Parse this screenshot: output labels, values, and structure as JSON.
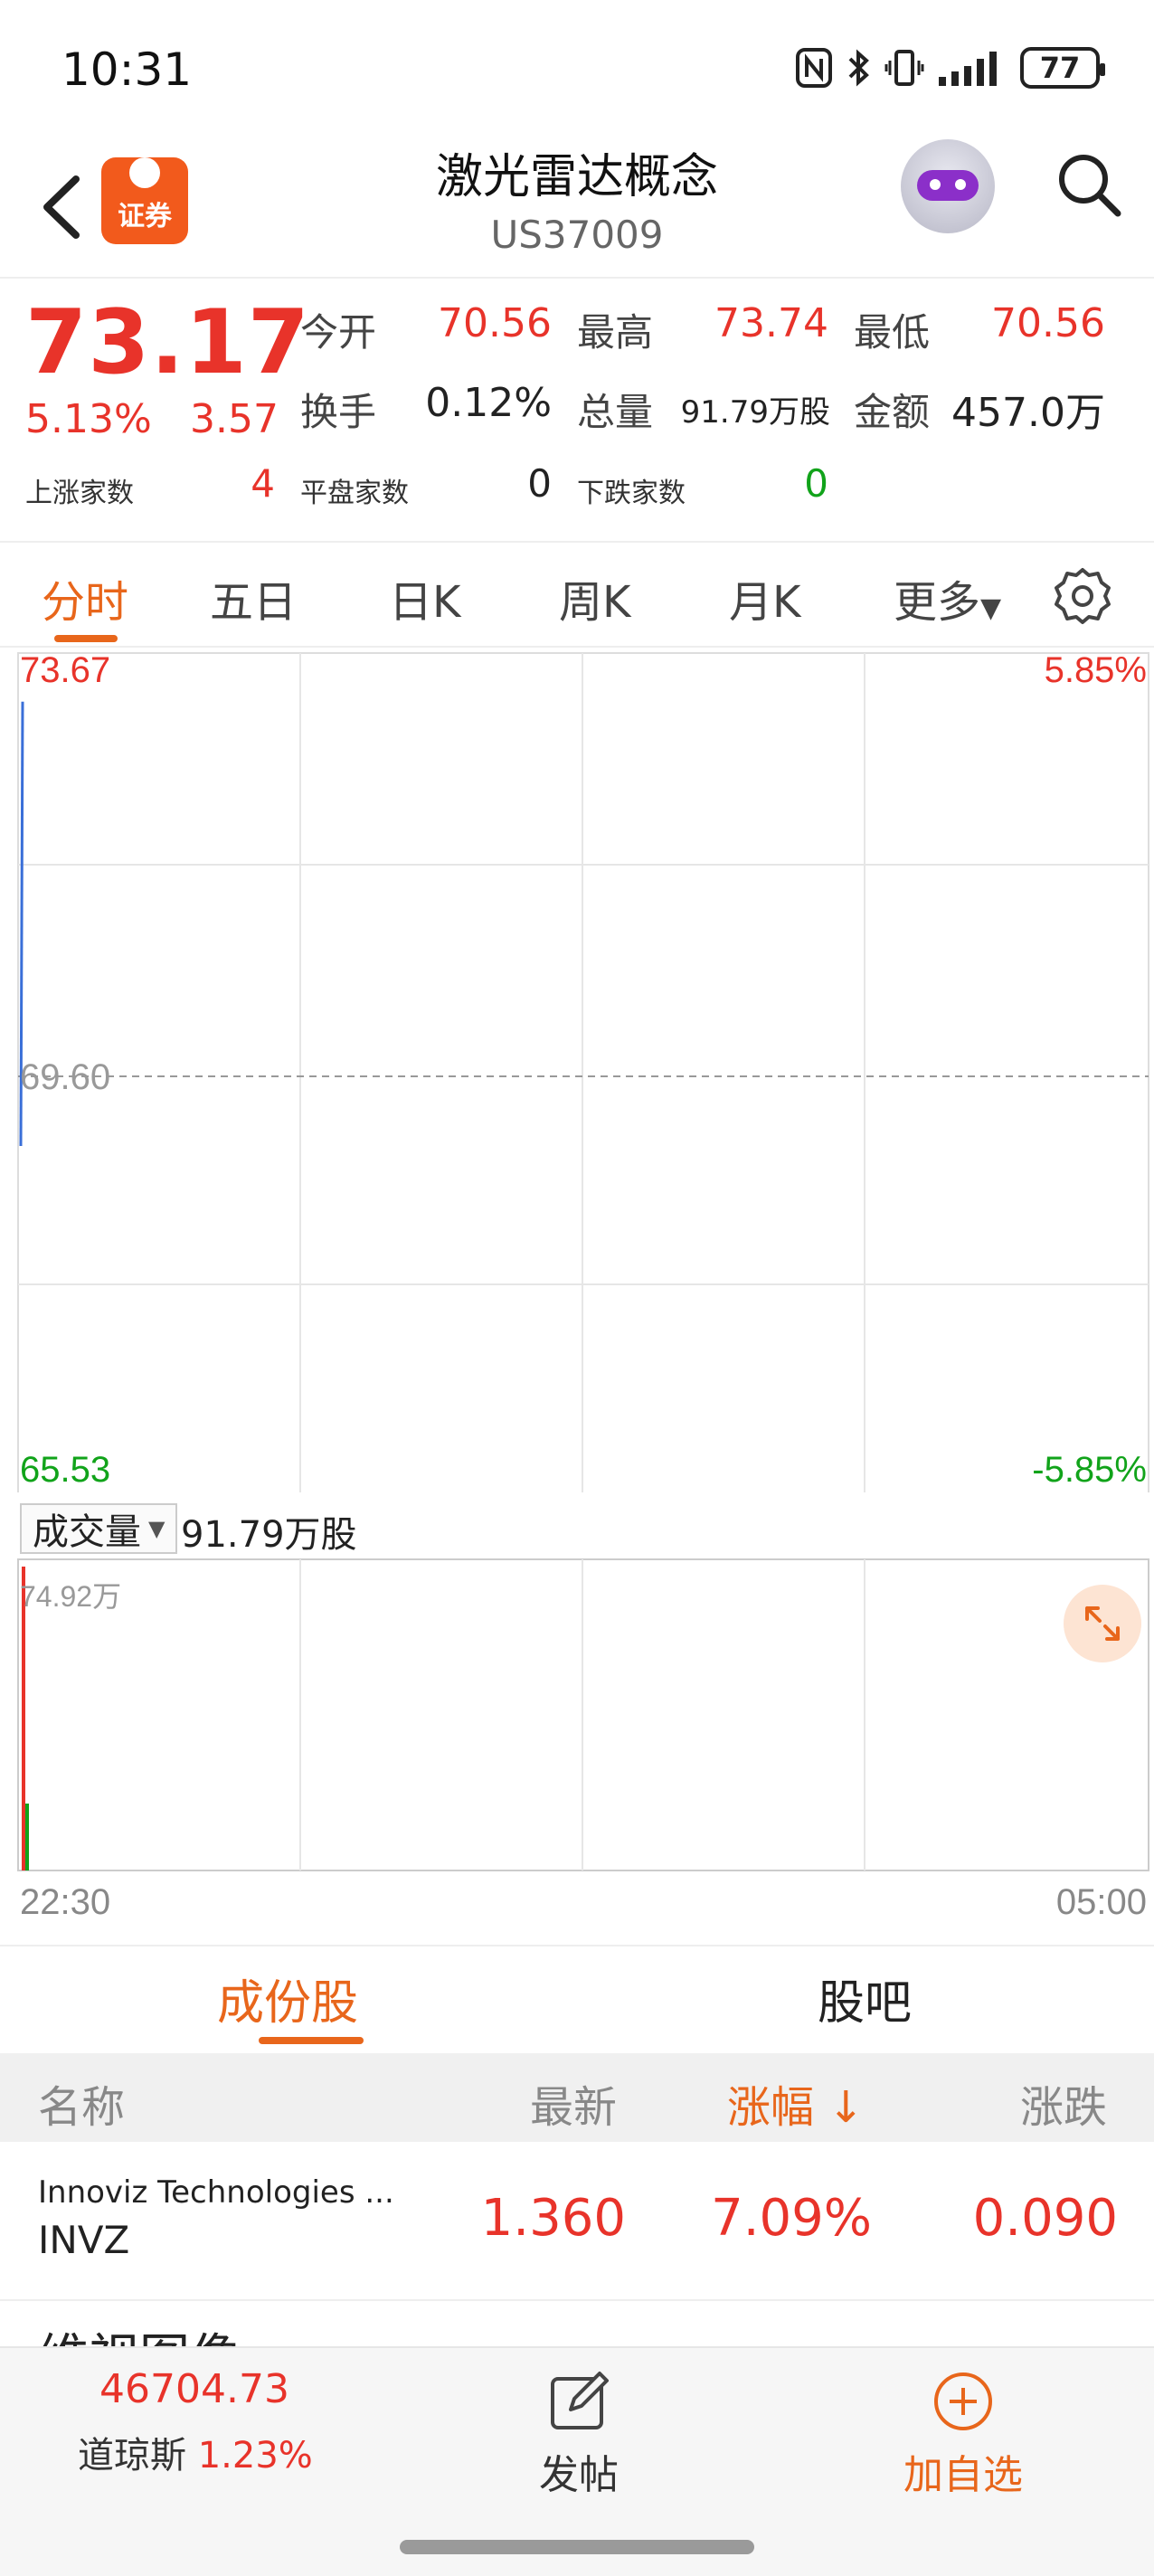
{
  "status": {
    "time": "10:31",
    "battery": "77"
  },
  "header": {
    "title": "激光雷达概念",
    "code": "US37009",
    "logo_text": "证券"
  },
  "quote": {
    "price": "73.17",
    "change_pct": "5.13%",
    "change_abs": "3.57",
    "open_label": "今开",
    "open": "70.56",
    "high_label": "最高",
    "high": "73.74",
    "low_label": "最低",
    "low": "70.56",
    "turnover_label": "换手",
    "turnover": "0.12%",
    "volume_label": "总量",
    "volume": "91.79万股",
    "amount_label": "金额",
    "amount": "457.0万",
    "up_label": "上涨家数",
    "up": "4",
    "flat_label": "平盘家数",
    "flat": "0",
    "down_label": "下跌家数",
    "down": "0"
  },
  "period_tabs": [
    "分时",
    "五日",
    "日K",
    "周K",
    "月K",
    "更多"
  ],
  "chart": {
    "y_high": "73.67",
    "y_mid": "69.60",
    "y_low": "65.53",
    "pct_high": "5.85%",
    "pct_low": "-5.85%",
    "vol_selector": "成交量",
    "vol_total": "91.79万股",
    "vol_max": "74.92万",
    "time_start": "22:30",
    "time_end": "05:00"
  },
  "chart_data": {
    "type": "line",
    "ylim": [
      65.53,
      73.67
    ],
    "ticks": [
      "73.67",
      "69.60",
      "65.53"
    ],
    "series": [
      {
        "values": [
          68.9,
          73.2
        ]
      }
    ]
  },
  "section_tabs": [
    "成份股",
    "股吧"
  ],
  "table": {
    "headers": [
      "名称",
      "最新",
      "涨幅 ↓",
      "涨跌"
    ],
    "rows": [
      {
        "name": "Innoviz Technologies ...",
        "code": "INVZ",
        "last": "1.360",
        "pct": "7.09%",
        "chg": "0.090"
      }
    ],
    "next_peek": "维视图像"
  },
  "footer": {
    "index_value": "46704.73",
    "index_name": "道琼斯",
    "index_pct": "1.23%",
    "post_label": "发帖",
    "add_label": "加自选"
  }
}
